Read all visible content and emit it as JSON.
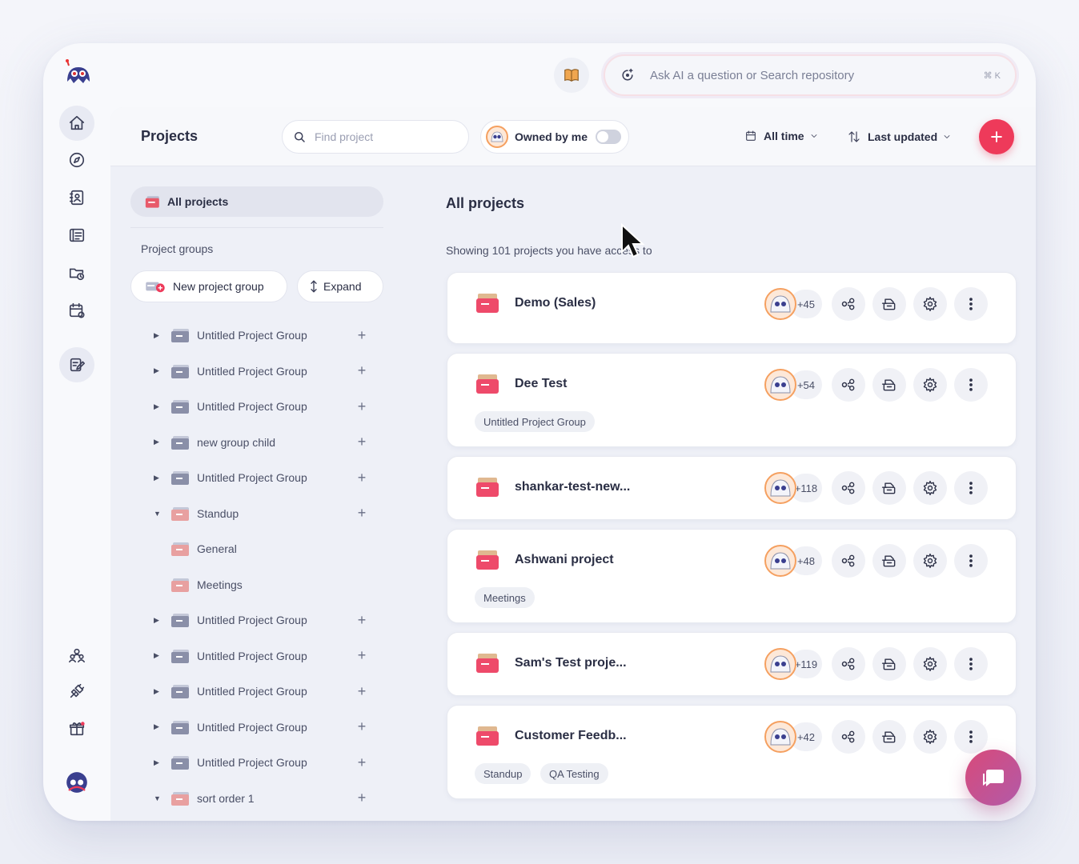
{
  "topbar": {
    "ai_search_placeholder": "Ask AI a question or Search repository",
    "ai_search_shortcut": "⌘ K"
  },
  "toolbar": {
    "title": "Projects",
    "find_placeholder": "Find project",
    "owned_by_me_label": "Owned by me",
    "owned_by_me_enabled": false,
    "time_filter": "All time",
    "sort_label": "Last updated"
  },
  "groups": {
    "all_projects_label": "All projects",
    "section_label": "Project groups",
    "new_group_label": "New project group",
    "expand_label": "Expand",
    "items": [
      {
        "label": "Untitled Project Group",
        "expanded": false
      },
      {
        "label": "Untitled Project Group",
        "expanded": false
      },
      {
        "label": "Untitled Project Group",
        "expanded": false
      },
      {
        "label": "new group child",
        "expanded": false
      },
      {
        "label": "Untitled Project Group",
        "expanded": false
      },
      {
        "label": "Standup",
        "expanded": true
      },
      {
        "label": "General",
        "child": true
      },
      {
        "label": "Meetings",
        "child": true
      },
      {
        "label": "Untitled Project Group",
        "expanded": false
      },
      {
        "label": "Untitled Project Group",
        "expanded": false
      },
      {
        "label": "Untitled Project Group",
        "expanded": false
      },
      {
        "label": "Untitled Project Group",
        "expanded": false
      },
      {
        "label": "Untitled Project Group",
        "expanded": false
      },
      {
        "label": "sort order 1",
        "expanded": true
      }
    ]
  },
  "main": {
    "heading": "All projects",
    "showing_text": "Showing 101 projects you have access to",
    "projects": [
      {
        "name": "Demo (Sales)",
        "members_extra": "+45",
        "tags": []
      },
      {
        "name": "Dee Test",
        "members_extra": "+54",
        "tags": [
          "Untitled Project Group"
        ]
      },
      {
        "name": "shankar-test-new...",
        "members_extra": "+118",
        "tags": []
      },
      {
        "name": "Ashwani project",
        "members_extra": "+48",
        "tags": [
          "Meetings"
        ]
      },
      {
        "name": "Sam's Test proje...",
        "members_extra": "+119",
        "tags": []
      },
      {
        "name": "Customer Feedb...",
        "members_extra": "+42",
        "tags": [
          "Standup",
          "QA Testing"
        ]
      }
    ]
  },
  "colors": {
    "accent": "#ee3a5a",
    "panel_bg": "#eef0f7",
    "chat_gradient_start": "#d84a7a",
    "chat_gradient_end": "#b25aa8"
  }
}
